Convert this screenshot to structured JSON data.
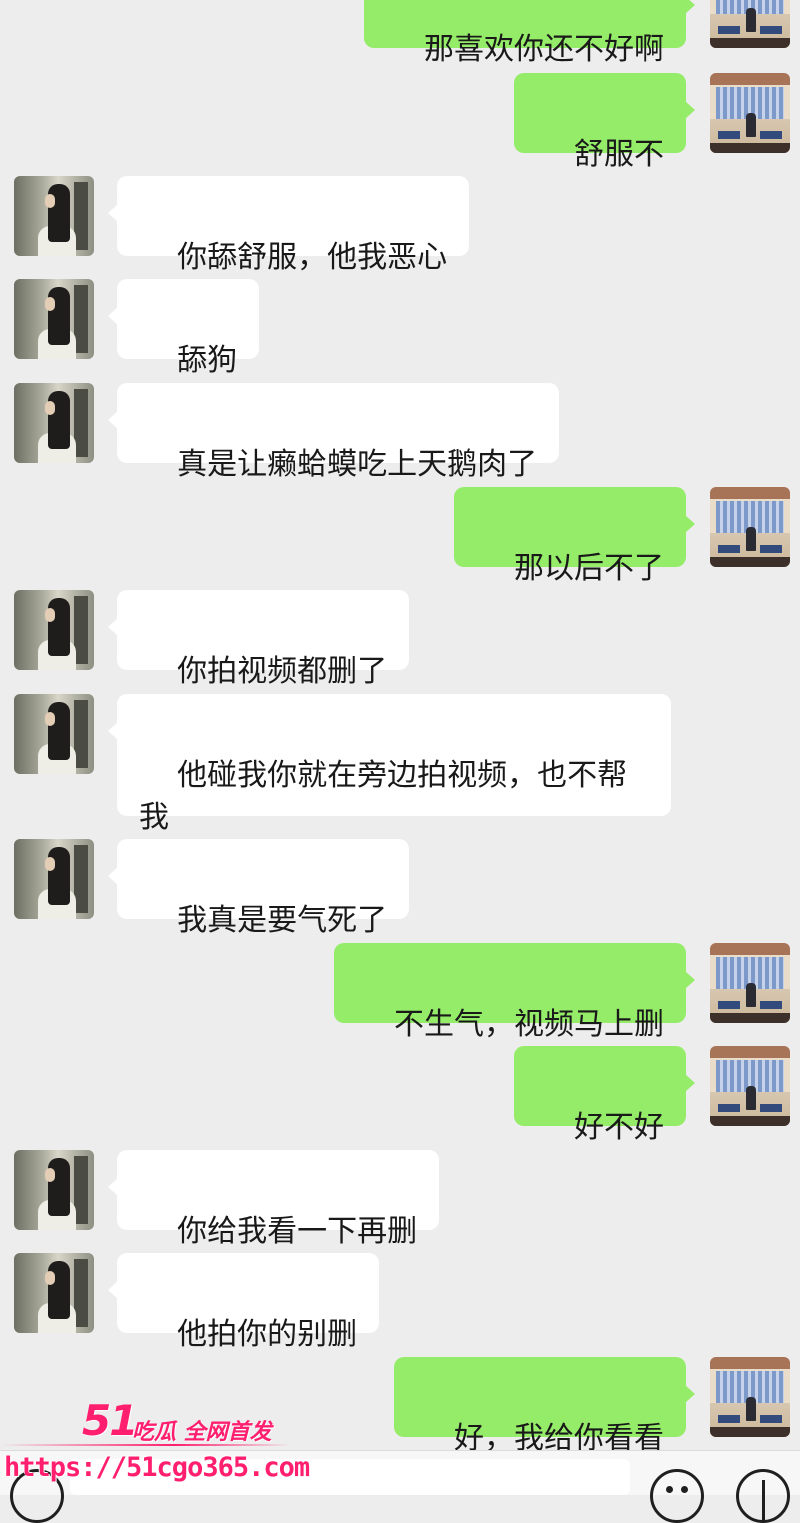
{
  "chat": {
    "messages": [
      {
        "side": "right",
        "text": "那喜欢你还不好啊"
      },
      {
        "side": "right",
        "text": "舒服不"
      },
      {
        "side": "left",
        "text": "你舔舒服，他我恶心"
      },
      {
        "side": "left",
        "text": "舔狗"
      },
      {
        "side": "left",
        "text": "真是让癞蛤蟆吃上天鹅肉了"
      },
      {
        "side": "right",
        "text": "那以后不了"
      },
      {
        "side": "left",
        "text": "你拍视频都删了"
      },
      {
        "side": "left",
        "text": "他碰我你就在旁边拍视频，也不帮我"
      },
      {
        "side": "left",
        "text": "我真是要气死了"
      },
      {
        "side": "right",
        "text": "不生气，视频马上删"
      },
      {
        "side": "right",
        "text": "好不好"
      },
      {
        "side": "left",
        "text": "你给我看一下再删"
      },
      {
        "side": "left",
        "text": "他拍你的别删"
      },
      {
        "side": "right",
        "text": "好，我给你看看"
      }
    ]
  },
  "colors": {
    "background": "#ededed",
    "self_bubble": "#95ec69",
    "other_bubble": "#ffffff",
    "watermark": "#ff1f6e"
  },
  "input_bar": {
    "icons": [
      "voice-icon",
      "emoji-icon",
      "plus-icon"
    ]
  },
  "watermark": {
    "logo": "51",
    "tagline": "吃瓜 全网首发",
    "url": "https://51cgo365.com"
  }
}
